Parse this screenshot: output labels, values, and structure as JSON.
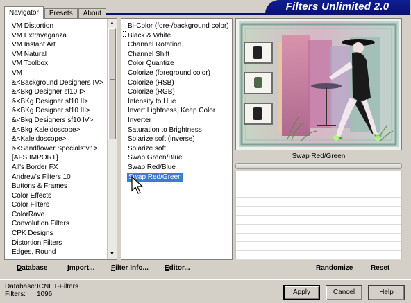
{
  "window": {
    "title": "Filters Unlimited 2.0"
  },
  "tabs": [
    {
      "label": "Navigator",
      "active": true
    },
    {
      "label": "Presets",
      "active": false
    },
    {
      "label": "About",
      "active": false
    }
  ],
  "categories": [
    "VM Distortion",
    "VM Extravaganza",
    "VM Instant Art",
    "VM Natural",
    "VM Toolbox",
    "VM",
    "&<Background Designers IV>",
    "&<Bkg Designer sf10 I>",
    "&<BKg Designer sf10 II>",
    "&<BKg Designer sf10 III>",
    "&<Bkg Designers sf10 IV>",
    "&<Bkg Kaleidoscope>",
    "&<Kaleidoscope>",
    "&<Sandflower Specials\"v\" >",
    "[AFS IMPORT]",
    "All's Border FX",
    "Andrew's Filters 10",
    "Buttons & Frames",
    "Color Effects",
    "Color Filters",
    "ColorRave",
    "Convolution Filters",
    "CPK Designs",
    "Distortion Filters",
    "Edges, Round"
  ],
  "filters": [
    "Bi-Color (fore-/background color)",
    "Black & White",
    "Channel Rotation",
    "Channel Shift",
    "Color Quantize",
    "Colorize (foreground color)",
    "Colorize (HSB)",
    "Colorize (RGB)",
    "Intensity to Hue",
    "Invert Lightness, Keep Color",
    "Inverter",
    "Saturation to Brightness",
    "Solarize soft (inverse)",
    "Solarize soft",
    "Swap Green/Blue",
    "Swap Red/Blue",
    "Swap Red/Green"
  ],
  "selected_filter_index": 16,
  "preview": {
    "filter_name": "Swap Red/Green"
  },
  "toolbar": {
    "database": "Database",
    "import": "Import...",
    "filter_info": "Filter Info...",
    "editor": "Editor...",
    "randomize": "Randomize",
    "reset": "Reset"
  },
  "status": {
    "database_label": "Database:",
    "database_value": "ICNET-Filters",
    "filters_label": "Filters:",
    "filters_value": "1096"
  },
  "buttons": {
    "apply": "Apply",
    "cancel": "Cancel",
    "help": "Help"
  },
  "colors": {
    "selection": "#3b7bd8",
    "banner": "#0f1e92",
    "accent_green": "#2fa84a"
  }
}
